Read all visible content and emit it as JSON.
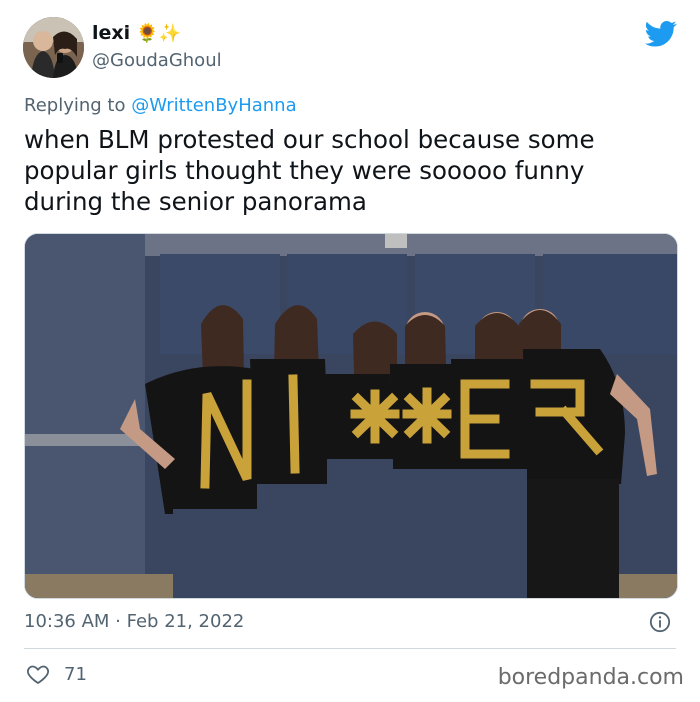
{
  "user": {
    "display_name": "lexi",
    "name_emoji": "🌻✨",
    "handle": "@GoudaGhoul",
    "avatar_icon": "profile-photo"
  },
  "reply": {
    "prefix": "Replying to",
    "mention": "@WrittenByHanna"
  },
  "tweet_text": "when BLM protested our school because some popular girls thought they were sooooo funny during the senior panorama",
  "media": {
    "description_icon": "photo-of-six-girls-in-black-shirts"
  },
  "timestamp": "10:36 AM · Feb 21, 2022",
  "likes": "71",
  "watermark": "boredpanda.com",
  "colors": {
    "brand_blue": "#1d9bf0",
    "secondary_text": "#536471"
  }
}
